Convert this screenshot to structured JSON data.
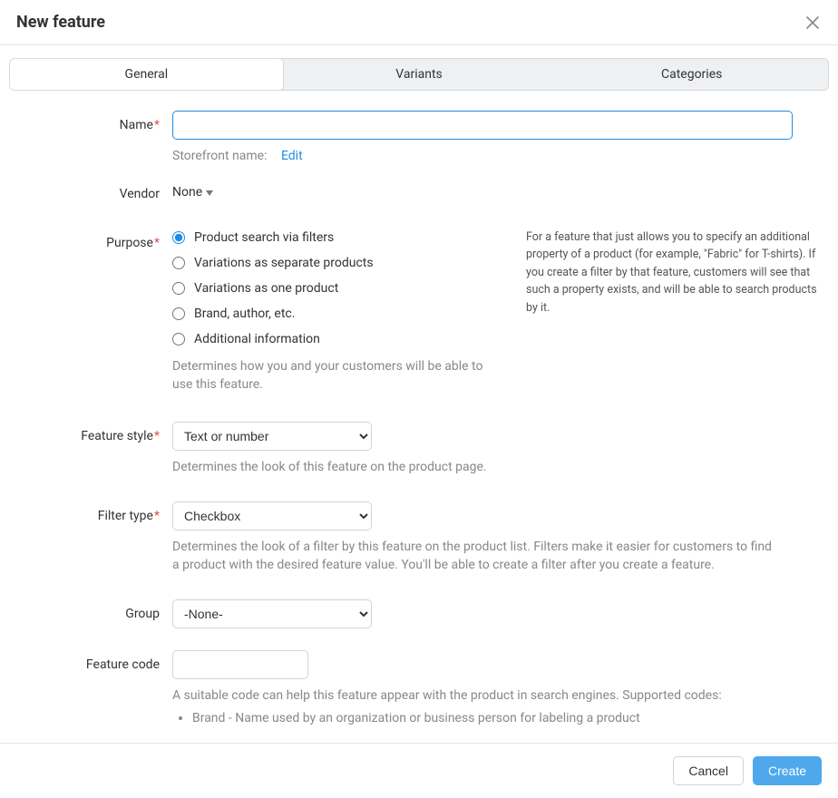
{
  "header": {
    "title": "New feature"
  },
  "tabs": [
    {
      "label": "General"
    },
    {
      "label": "Variants"
    },
    {
      "label": "Categories"
    }
  ],
  "name_field": {
    "label": "Name",
    "value": "",
    "storefront_label": "Storefront name:",
    "edit_label": "Edit"
  },
  "vendor_field": {
    "label": "Vendor",
    "value": "None"
  },
  "purpose_field": {
    "label": "Purpose",
    "options": [
      "Product search via filters",
      "Variations as separate products",
      "Variations as one product",
      "Brand, author, etc.",
      "Additional information"
    ],
    "selected_index": 0,
    "help": "Determines how you and your customers will be able to use this feature.",
    "side_note": "For a feature that just allows you to specify an additional property of a product (for example, \"Fabric\" for T-shirts). If you create a filter by that feature, customers will see that such a property exists, and will be able to search products by it."
  },
  "feature_style": {
    "label": "Feature style",
    "value": "Text or number",
    "help": "Determines the look of this feature on the product page."
  },
  "filter_type": {
    "label": "Filter type",
    "value": "Checkbox",
    "help": "Determines the look of a filter by this feature on the product list. Filters make it easier for customers to find a product with the desired feature value. You'll be able to create a filter after you create a feature."
  },
  "group": {
    "label": "Group",
    "value": "-None-"
  },
  "feature_code": {
    "label": "Feature code",
    "value": "",
    "help": "A suitable code can help this feature appear with the product in search engines. Supported codes:",
    "codes": [
      "Brand - Name used by an organization or business person for labeling a product"
    ]
  },
  "footer": {
    "cancel": "Cancel",
    "create": "Create"
  }
}
